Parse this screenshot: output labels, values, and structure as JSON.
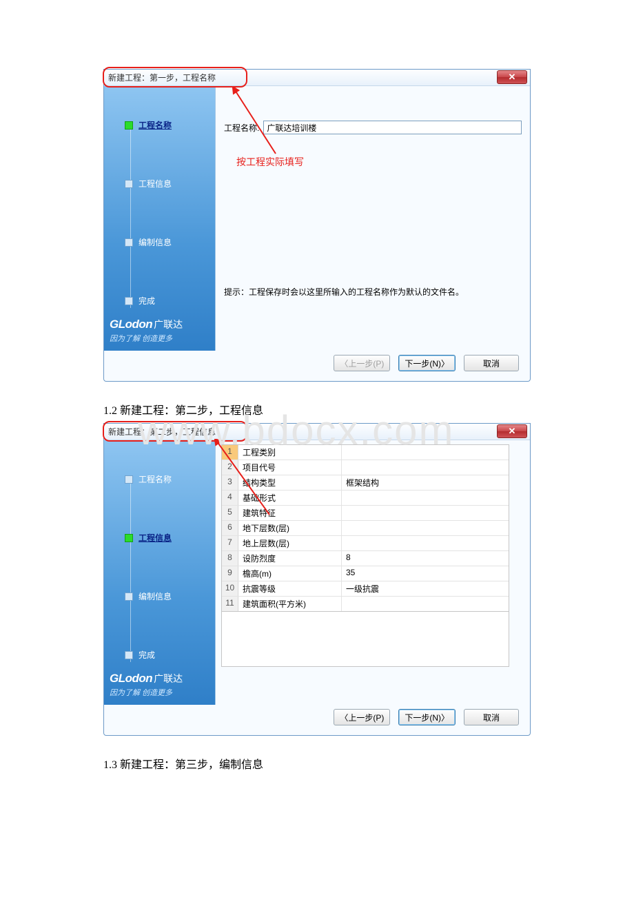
{
  "watermark": "www.bdocx.com",
  "dialog1": {
    "title": "新建工程：第一步，工程名称",
    "close": "✕",
    "steps": [
      "工程名称",
      "工程信息",
      "编制信息",
      "完成"
    ],
    "active_index": 0,
    "form_label": "工程名称:",
    "form_value": "广联达培训楼",
    "annotation": "按工程实际填写",
    "tip": "提示：工程保存时会以这里所输入的工程名称作为默认的文件名。",
    "prev_btn": "〈上一步(P)",
    "next_btn": "下一步(N)〉",
    "cancel_btn": "取消",
    "brand_logo": "GLodon",
    "brand_cn": "广联达",
    "brand_tag": "因为了解 创造更多"
  },
  "heading2": "1.2 新建工程：第二步，工程信息",
  "dialog2": {
    "title": "新建工程：第二步，工程信息",
    "close": "✕",
    "steps": [
      "工程名称",
      "工程信息",
      "编制信息",
      "完成"
    ],
    "active_index": 1,
    "rows": [
      {
        "n": "1",
        "k": "工程类别",
        "v": "",
        "sel": true
      },
      {
        "n": "2",
        "k": "项目代号",
        "v": ""
      },
      {
        "n": "3",
        "k": "结构类型",
        "v": "框架结构"
      },
      {
        "n": "4",
        "k": "基础形式",
        "v": ""
      },
      {
        "n": "5",
        "k": "建筑特征",
        "v": ""
      },
      {
        "n": "6",
        "k": "地下层数(层)",
        "v": ""
      },
      {
        "n": "7",
        "k": "地上层数(层)",
        "v": ""
      },
      {
        "n": "8",
        "k": "设防烈度",
        "v": "8"
      },
      {
        "n": "9",
        "k": "檐高(m)",
        "v": "35"
      },
      {
        "n": "10",
        "k": "抗震等级",
        "v": "一级抗震"
      },
      {
        "n": "11",
        "k": "建筑面积(平方米)",
        "v": ""
      }
    ],
    "prev_btn": "〈上一步(P)",
    "next_btn": "下一步(N)〉",
    "cancel_btn": "取消",
    "brand_logo": "GLodon",
    "brand_cn": "广联达",
    "brand_tag": "因为了解 创造更多"
  },
  "heading3": "1.3 新建工程：第三步，编制信息"
}
